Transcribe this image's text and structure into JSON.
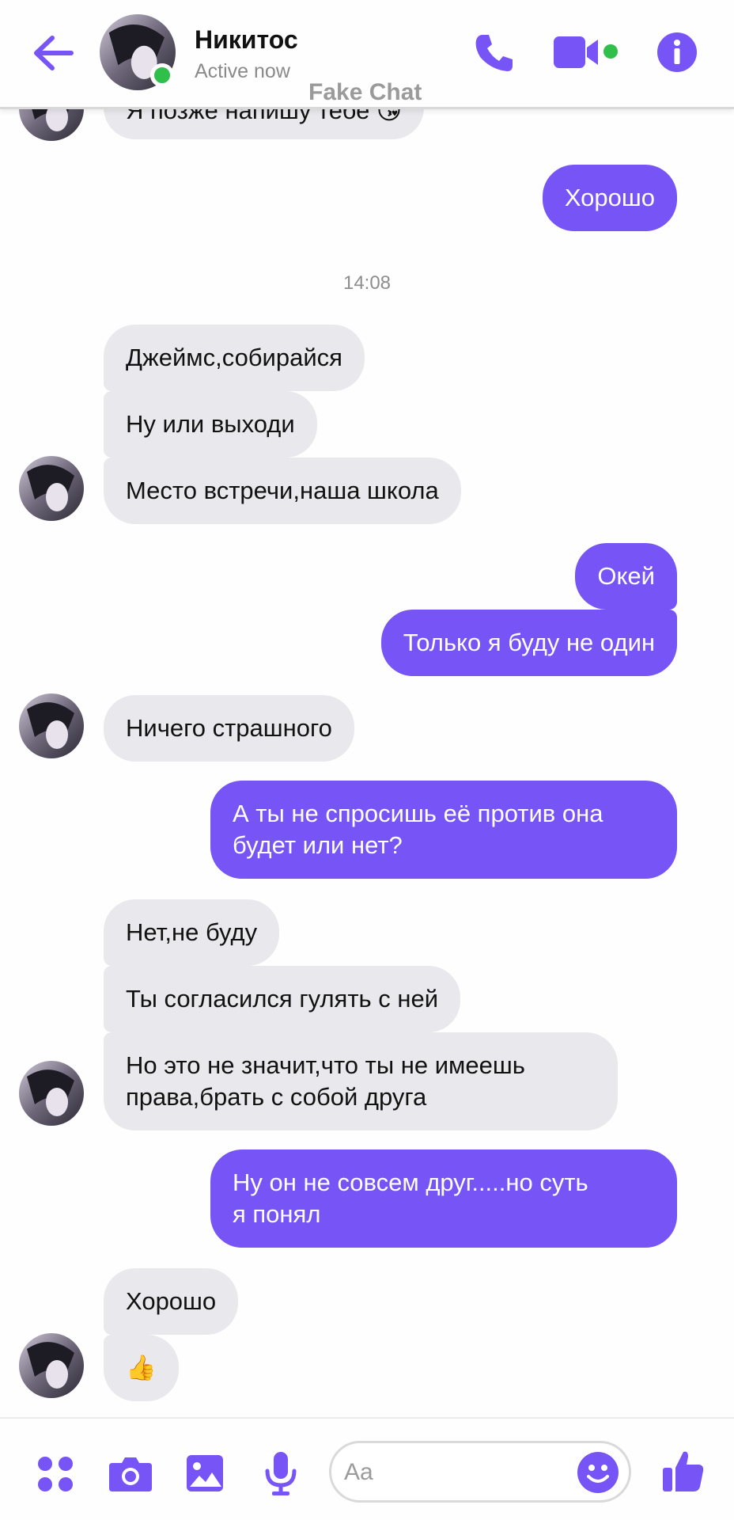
{
  "header": {
    "contact_name": "Никитос",
    "status": "Active now",
    "watermark": "Fake Chat"
  },
  "icons": {
    "back": "arrow-left-icon",
    "call": "phone-icon",
    "video": "video-camera-icon",
    "info": "info-icon",
    "apps": "dots-grid-icon",
    "camera": "camera-icon",
    "gallery": "image-icon",
    "mic": "microphone-icon",
    "emoji": "smiley-icon",
    "like": "thumbs-up-icon"
  },
  "colors": {
    "accent": "#7654f5",
    "online": "#2fbf4a",
    "incoming_bubble": "#e9e8ec"
  },
  "chat": {
    "timestamp": "14:08",
    "messages": [
      {
        "dir": "in",
        "text": "Я позже напишу тебе 😘"
      },
      {
        "dir": "out",
        "text": "Хорошо"
      },
      {
        "dir": "in",
        "text": "Джеймс,собирайся"
      },
      {
        "dir": "in",
        "text": "Ну или выходи"
      },
      {
        "dir": "in",
        "text": "Место встречи,наша школа"
      },
      {
        "dir": "out",
        "text": "Окей"
      },
      {
        "dir": "out",
        "text": "Только я буду не один"
      },
      {
        "dir": "in",
        "text": "Ничего страшного"
      },
      {
        "dir": "out",
        "text": "А ты не спросишь её против она\nбудет или нет?"
      },
      {
        "dir": "in",
        "text": "Нет,не буду"
      },
      {
        "dir": "in",
        "text": "Ты согласился гулять с ней"
      },
      {
        "dir": "in",
        "text": "Но это не значит,что ты не имеешь\nправа,брать с собой друга"
      },
      {
        "dir": "out",
        "text": "Ну он не совсем друг.....но суть\nя понял"
      },
      {
        "dir": "in",
        "text": "Хорошо"
      },
      {
        "dir": "in",
        "text": "👍"
      }
    ]
  },
  "composer": {
    "placeholder": "Aa"
  }
}
